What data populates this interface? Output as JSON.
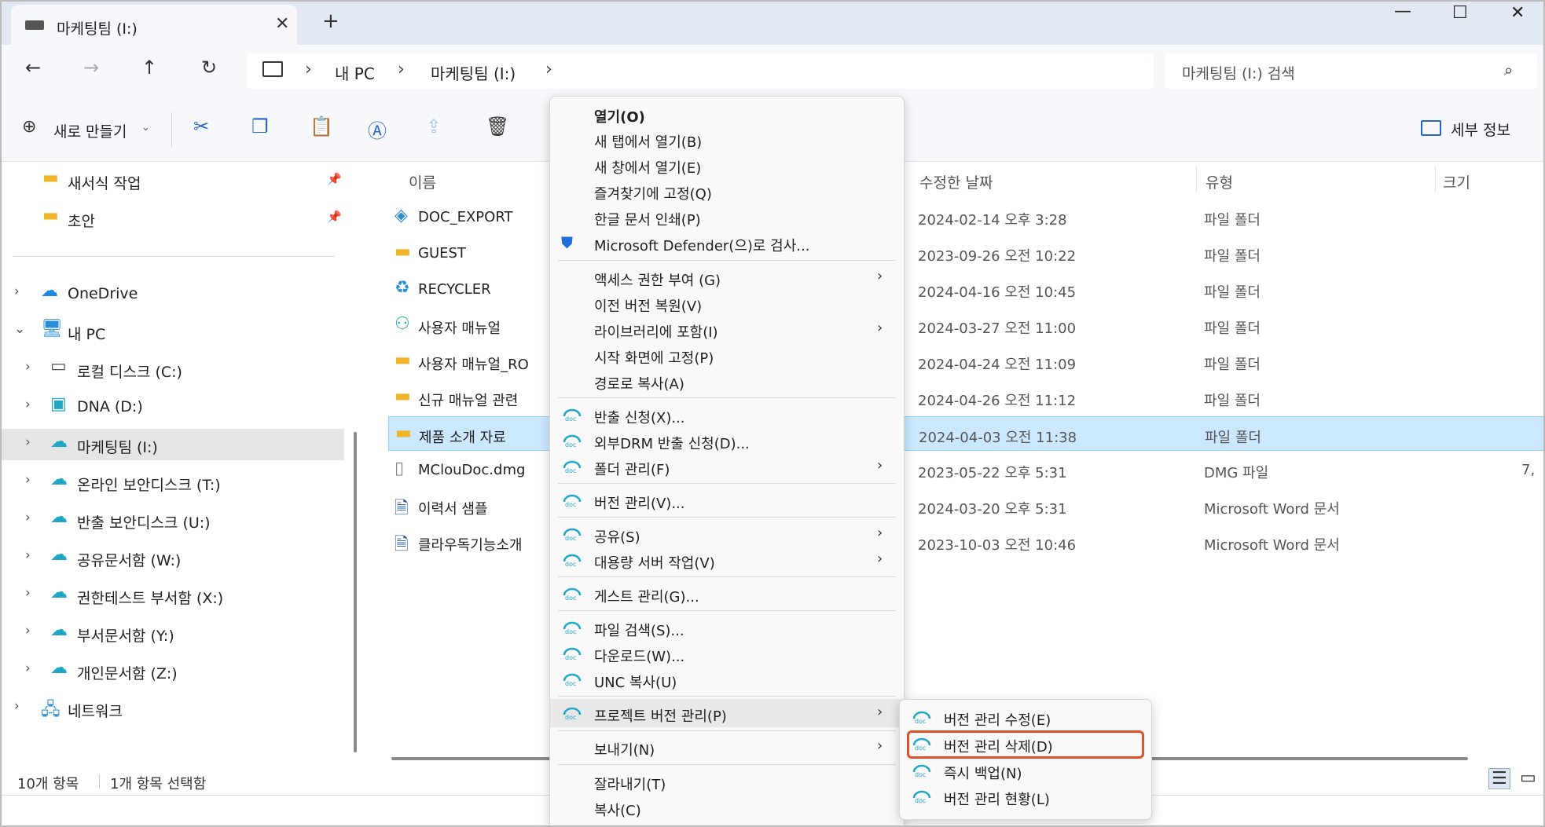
{
  "tab": {
    "title": "마케팅팀 (I:)",
    "close": "✕",
    "add": "+"
  },
  "window_controls": {
    "minimize": "—",
    "maximize": "☐",
    "close": "✕"
  },
  "nav": {
    "back": "←",
    "forward": "→",
    "up": "↑",
    "refresh": "↻",
    "crumbs": [
      "내 PC",
      "마케팅팀 (I:)"
    ],
    "crumb_sep": "›"
  },
  "search": {
    "placeholder": "마케팅팀 (I:) 검색"
  },
  "commandbar": {
    "new_label": "새로 만들기",
    "details_label": "세부 정보"
  },
  "sidebar": {
    "quick": [
      {
        "label": "새서식 작업",
        "pinned": true
      },
      {
        "label": "초안",
        "pinned": true
      }
    ],
    "tree": [
      {
        "label": "OneDrive",
        "level": 0,
        "expanded": false
      },
      {
        "label": "내 PC",
        "level": 0,
        "expanded": true
      },
      {
        "label": "로컬 디스크 (C:)",
        "level": 1
      },
      {
        "label": "DNA (D:)",
        "level": 1
      },
      {
        "label": "마케팅팀 (I:)",
        "level": 1,
        "selected": true
      },
      {
        "label": "온라인 보안디스크 (T:)",
        "level": 1
      },
      {
        "label": "반출 보안디스크 (U:)",
        "level": 1
      },
      {
        "label": "공유문서함 (W:)",
        "level": 1
      },
      {
        "label": "권한테스트 부서함 (X:)",
        "level": 1
      },
      {
        "label": "부서문서함 (Y:)",
        "level": 1
      },
      {
        "label": "개인문서함 (Z:)",
        "level": 1
      },
      {
        "label": "네트워크",
        "level": 0,
        "expanded": false
      }
    ]
  },
  "columns": {
    "name": "이름",
    "modified": "수정한 날짜",
    "type": "유형",
    "size": "크기"
  },
  "files": [
    {
      "name": "DOC_EXPORT",
      "modified": "2024-02-14 오후 3:28",
      "type": "파일 폴더",
      "size": ""
    },
    {
      "name": "GUEST",
      "modified": "2023-09-26 오전 10:22",
      "type": "파일 폴더",
      "size": ""
    },
    {
      "name": "RECYCLER",
      "modified": "2024-04-16 오전 10:45",
      "type": "파일 폴더",
      "size": ""
    },
    {
      "name": "사용자 매뉴얼",
      "modified": "2024-03-27 오전 11:00",
      "type": "파일 폴더",
      "size": ""
    },
    {
      "name": "사용자 매뉴얼_RO",
      "modified": "2024-04-24 오전 11:09",
      "type": "파일 폴더",
      "size": ""
    },
    {
      "name": "신규 매뉴얼 관련",
      "modified": "2024-04-26 오전 11:12",
      "type": "파일 폴더",
      "size": ""
    },
    {
      "name": "제품 소개 자료",
      "modified": "2024-04-03 오전 11:38",
      "type": "파일 폴더",
      "size": "",
      "selected": true
    },
    {
      "name": "MClouDoc.dmg",
      "modified": "2023-05-22 오후 5:31",
      "type": "DMG 파일",
      "size": "7,"
    },
    {
      "name": "이력서 샘플",
      "modified": "2024-03-20 오후 5:31",
      "type": "Microsoft Word 문서",
      "size": ""
    },
    {
      "name": "클라우독기능소개",
      "modified": "2023-10-03 오전 10:46",
      "type": "Microsoft Word 문서",
      "size": ""
    }
  ],
  "status": {
    "count": "10개 항목",
    "selected": "1개 항목 선택함"
  },
  "context_menu": {
    "group1": [
      {
        "label": "열기(O)",
        "bold": true
      },
      {
        "label": "새 탭에서 열기(B)"
      },
      {
        "label": "새 창에서 열기(E)"
      },
      {
        "label": "즐겨찾기에 고정(Q)"
      },
      {
        "label": "한글 문서 인쇄(P)"
      },
      {
        "label": "Microsoft Defender(으)로 검사...",
        "icon": "shield"
      }
    ],
    "group2": [
      {
        "label": "액세스 권한 부여 (G)",
        "arrow": true
      },
      {
        "label": "이전 버전 복원(V)"
      },
      {
        "label": "라이브러리에 포함(I)",
        "arrow": true
      },
      {
        "label": "시작 화면에 고정(P)"
      },
      {
        "label": "경로로 복사(A)"
      }
    ],
    "group3": [
      {
        "label": "반출 신청(X)...",
        "icon": "doc"
      },
      {
        "label": "외부DRM 반출 신청(D)...",
        "icon": "doc"
      },
      {
        "label": "폴더 관리(F)",
        "icon": "doc",
        "arrow": true
      }
    ],
    "group4": [
      {
        "label": "버전 관리(V)...",
        "icon": "doc"
      }
    ],
    "group5": [
      {
        "label": "공유(S)",
        "icon": "doc",
        "arrow": true
      },
      {
        "label": "대용량 서버 작업(V)",
        "icon": "doc",
        "arrow": true
      }
    ],
    "group6": [
      {
        "label": "게스트 관리(G)...",
        "icon": "doc"
      }
    ],
    "group7": [
      {
        "label": "파일 검색(S)...",
        "icon": "doc"
      },
      {
        "label": "다운로드(W)...",
        "icon": "doc"
      },
      {
        "label": "UNC 복사(U)",
        "icon": "doc"
      }
    ],
    "group8": [
      {
        "label": "프로젝트 버전 관리(P)",
        "icon": "doc",
        "arrow": true,
        "highlight": true
      }
    ],
    "group9": [
      {
        "label": "보내기(N)",
        "arrow": true
      }
    ],
    "group10": [
      {
        "label": "잘라내기(T)"
      },
      {
        "label": "복사(C)"
      }
    ]
  },
  "submenu": [
    {
      "label": "버전 관리 수정(E)"
    },
    {
      "label": "버전 관리 삭제(D)",
      "focused": true
    },
    {
      "label": "즉시 백업(N)"
    },
    {
      "label": "버전 관리 현황(L)"
    }
  ],
  "colors": {
    "accent": "#2864c8",
    "selection": "#cce8ff",
    "focus_border": "#e0502a",
    "doc_icon": "#1fa9c7"
  }
}
